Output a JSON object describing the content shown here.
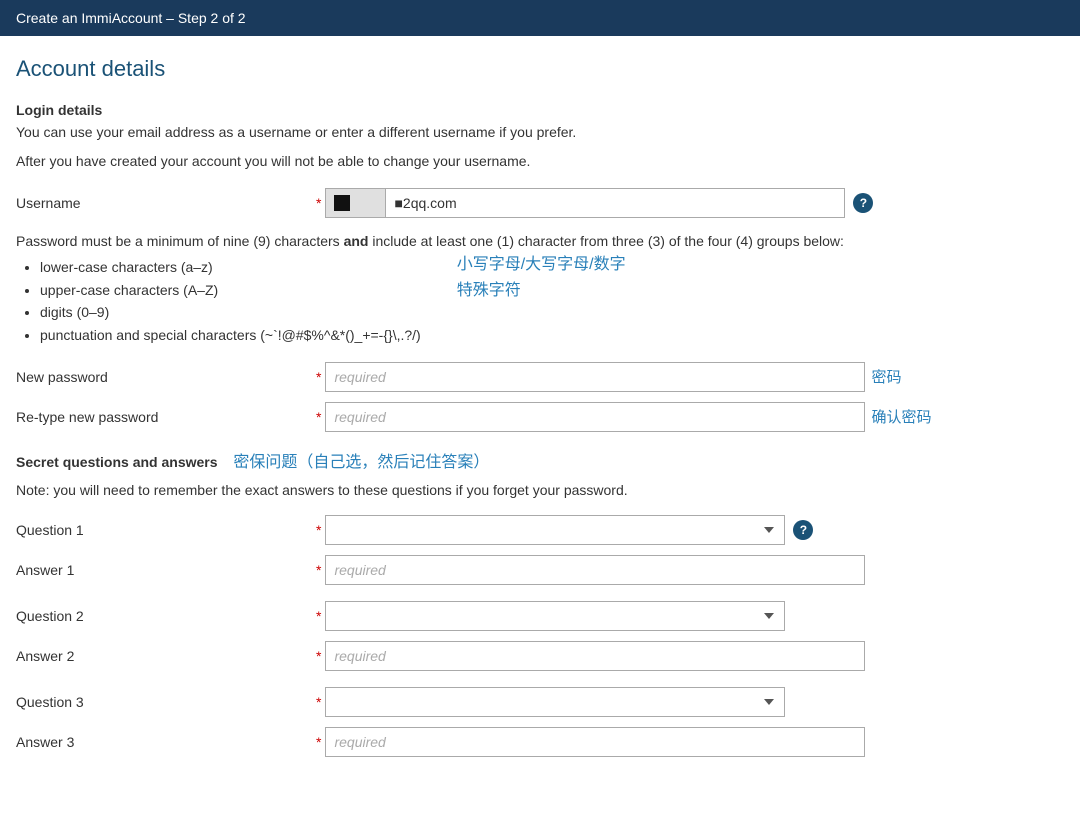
{
  "header": {
    "title": "Create an ImmiAccount – Step 2 of 2"
  },
  "page": {
    "title": "Account details",
    "login_section": {
      "heading": "Login details",
      "description1": "You can use your email address as a username or enter a different username if you prefer.",
      "description2": "After you have created your account you will not be able to change your username."
    },
    "username": {
      "label": "Username",
      "value": "■2qq.com",
      "prefix_content": "■"
    },
    "password_rules": {
      "intro": "Password must be a minimum of nine (9) characters",
      "intro_bold": "and",
      "intro_rest": " include at least one (1) character from three (3) of the four (4) groups below:",
      "annotation": "小写字母/大写字母/数字",
      "annotation2": "特殊字符",
      "rules": [
        "lower-case characters (a–z)",
        "upper-case characters (A–Z)",
        "digits (0–9)",
        "punctuation and special characters (~`!@#$%^&*()_+=-{}\\,.?/)"
      ]
    },
    "new_password": {
      "label": "New password",
      "placeholder": "required",
      "annotation": "密码"
    },
    "retype_password": {
      "label": "Re-type new password",
      "placeholder": "required",
      "annotation": "确认密码"
    },
    "secret_section": {
      "heading": "Secret questions and answers",
      "annotation": "密保问题（自己选，然后记住答案）",
      "note": "Note: you will need to remember the exact answers to these questions if you forget your password."
    },
    "questions": [
      {
        "question_label": "Question 1",
        "answer_label": "Answer 1",
        "answer_placeholder": "required",
        "has_help": true
      },
      {
        "question_label": "Question 2",
        "answer_label": "Answer 2",
        "answer_placeholder": "required",
        "has_help": false
      },
      {
        "question_label": "Question 3",
        "answer_label": "Answer 3",
        "answer_placeholder": "required",
        "has_help": false
      }
    ]
  }
}
